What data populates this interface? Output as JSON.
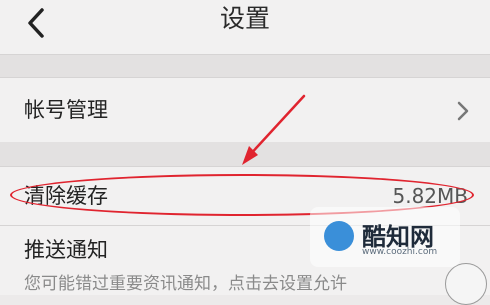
{
  "header": {
    "title": "设置",
    "back_icon": "chevron-left-icon"
  },
  "settings": {
    "account": {
      "label": "帐号管理",
      "chevron_icon": "chevron-right-icon"
    },
    "cache": {
      "label": "清除缓存",
      "value": "5.82MB"
    },
    "push": {
      "label": "推送通知",
      "description": "您可能错过重要资讯通知，点击去设置允许"
    }
  },
  "annotation": {
    "color": "#e0242f",
    "ring_target": "cache",
    "arrow_icon": "arrow-icon"
  },
  "watermark": {
    "name": "酷知网",
    "url": "www.coozhi.com"
  }
}
